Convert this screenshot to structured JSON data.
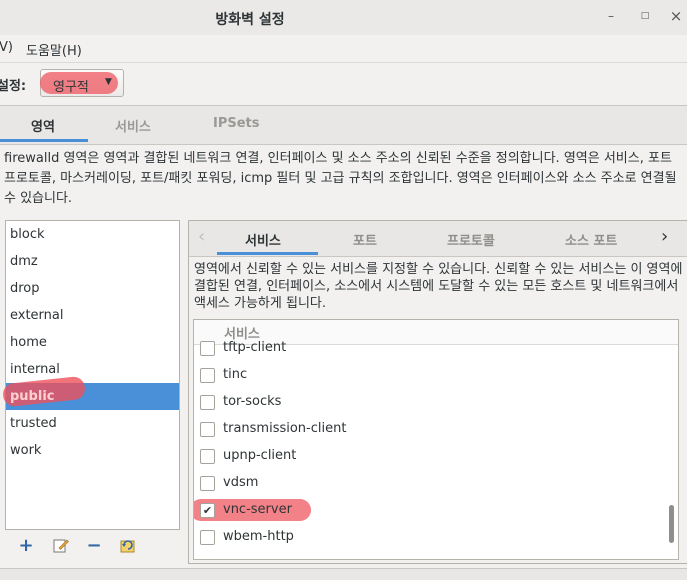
{
  "window": {
    "title": "방화벽 설정",
    "min_glyph": "–",
    "max_glyph": "□",
    "close_glyph": "×"
  },
  "menu": {
    "items": [
      "V)",
      "도움말(H)"
    ]
  },
  "config": {
    "label": "설정:",
    "value": "영구적"
  },
  "main_tabs": [
    "영역",
    "서비스",
    "IPSets"
  ],
  "description": "firewalld 영역은 영역과 결합된 네트워크 연결, 인터페이스 및 소스 주소의 신뢰된 수준을 정의합니다. 영역은 서비스, 포트 프로토콜, 마스커레이딩, 포트/패킷 포워딩, icmp 필터 및 고급 규칙의 조합입니다. 영역은 인터페이스와 소스 주소로 연결될 수 있습니다.",
  "zones": {
    "items": [
      "block",
      "dmz",
      "drop",
      "external",
      "home",
      "internal",
      "public",
      "trusted",
      "work"
    ],
    "selected": "public"
  },
  "sub_tabs": [
    "서비스",
    "포트",
    "프로토콜",
    "소스 포트"
  ],
  "services": {
    "description": "영역에서 신뢰할 수 있는 서비스를 지정할 수 있습니다. 신뢰할 수 있는 서비스는 이 영역에 결합된 연결, 인터페이스, 소스에서 시스템에 도달할 수 있는 모든 호스트 및 네트워크에서 액세스 가능하게 됩니다.",
    "column_header": "서비스",
    "rows": [
      {
        "name": "tftp-client",
        "checked": false
      },
      {
        "name": "tinc",
        "checked": false
      },
      {
        "name": "tor-socks",
        "checked": false
      },
      {
        "name": "transmission-client",
        "checked": false
      },
      {
        "name": "upnp-client",
        "checked": false
      },
      {
        "name": "vdsm",
        "checked": false
      },
      {
        "name": "vnc-server",
        "checked": true
      },
      {
        "name": "wbem-http",
        "checked": false
      }
    ]
  },
  "colors": {
    "accent": "#4a90d9",
    "highlight": "#ee505a"
  }
}
